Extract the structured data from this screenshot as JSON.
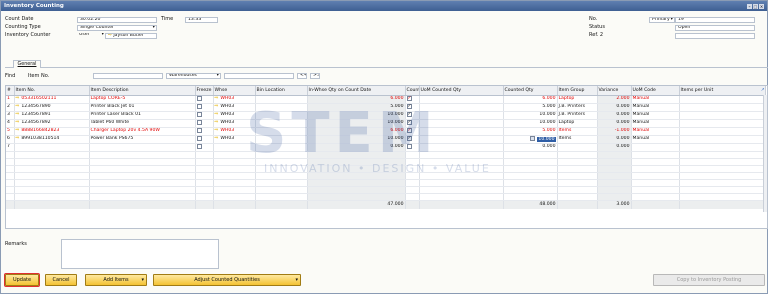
{
  "window": {
    "title": "Inventory Counting"
  },
  "header": {
    "count_date_label": "Count Date",
    "count_date": "30.02.20",
    "time_label": "Time",
    "time": "13:33",
    "counting_type_label": "Counting Type",
    "counting_type": "Single Counter",
    "inventory_counter_label": "Inventory Counter",
    "counter_kind": "User",
    "counter_name": "Jayson Butler",
    "no_label": "No.",
    "no_series": "Primary",
    "no_value": "19",
    "status_label": "Status",
    "status_value": "Open",
    "ref_label": "Ref. 2",
    "ref_value": ""
  },
  "tabs": {
    "general": "General"
  },
  "find": {
    "find_label": "Find",
    "item_no_label": "Item No.",
    "warehouses_label": "Warehouses"
  },
  "grid": {
    "columns": [
      "#",
      "Item No.",
      "Item Description",
      "Freeze",
      "Whse",
      "Bin Location",
      "In-Whse Qty on Count Date",
      "Counted",
      "UoM Counted Qty",
      "Counted Qty",
      "Item Group",
      "Variance",
      "UoM Code",
      "Items per Unit"
    ],
    "rows": [
      {
        "n": "1",
        "item_no": "053316502111",
        "desc": "Laptop CORE-5",
        "whse": "WH03",
        "inwhse": "6.000",
        "counted": true,
        "counted_qty": "6.000",
        "group": "Laptop",
        "variance": "2.000",
        "uom": "Manual",
        "red": true
      },
      {
        "n": "2",
        "item_no": "1234567890",
        "desc": "Printer Black Jet 01",
        "whse": "WH03",
        "inwhse": "5.000",
        "counted": true,
        "counted_qty": "5.000",
        "group": "J.B. Printers",
        "variance": "0.000",
        "uom": "Manual",
        "red": false
      },
      {
        "n": "3",
        "item_no": "1234567891",
        "desc": "Printer Laser Black 01",
        "whse": "WH03",
        "inwhse": "10.000",
        "counted": true,
        "counted_qty": "10.000",
        "group": "J.B. Printers",
        "variance": "0.000",
        "uom": "Manual",
        "red": false
      },
      {
        "n": "4",
        "item_no": "1234567892",
        "desc": "Tablet P60 White",
        "whse": "WH03",
        "inwhse": "10.000",
        "counted": true,
        "counted_qty": "10.000",
        "group": "Laptop",
        "variance": "0.000",
        "uom": "Manual",
        "red": false
      },
      {
        "n": "5",
        "item_no": "8888166842823",
        "desc": "Charger Laptop 20v 4.5A 90W",
        "whse": "WH03",
        "inwhse": "6.000",
        "counted": true,
        "counted_qty": "5.000",
        "group": "Items",
        "variance": "-1.000",
        "uom": "Manual",
        "red": true
      },
      {
        "n": "6",
        "item_no": "8991038110514",
        "desc": "Power Bank PS675",
        "whse": "WH03",
        "inwhse": "10.000",
        "counted": true,
        "counted_qty": "10.000",
        "group": "Items",
        "variance": "0.000",
        "uom": "Manual",
        "red": false
      },
      {
        "n": "7",
        "item_no": "",
        "desc": "",
        "whse": "",
        "inwhse": "0.000",
        "counted": false,
        "counted_qty": "0.000",
        "group": "",
        "variance": "0.000",
        "uom": "",
        "red": false
      }
    ],
    "totals": {
      "inwhse": "47.000",
      "counted_qty": "48.000",
      "variance": "3.000"
    }
  },
  "remarks_label": "Remarks",
  "buttons": {
    "update": "Update",
    "cancel": "Cancel",
    "add_items": "Add Items",
    "adjust": "Adjust Counted Quantities",
    "copy": "Copy to Inventory Posting"
  },
  "watermark": {
    "brand": "STEM",
    "tagline": "INNOVATION • DESIGN • VALUE"
  }
}
